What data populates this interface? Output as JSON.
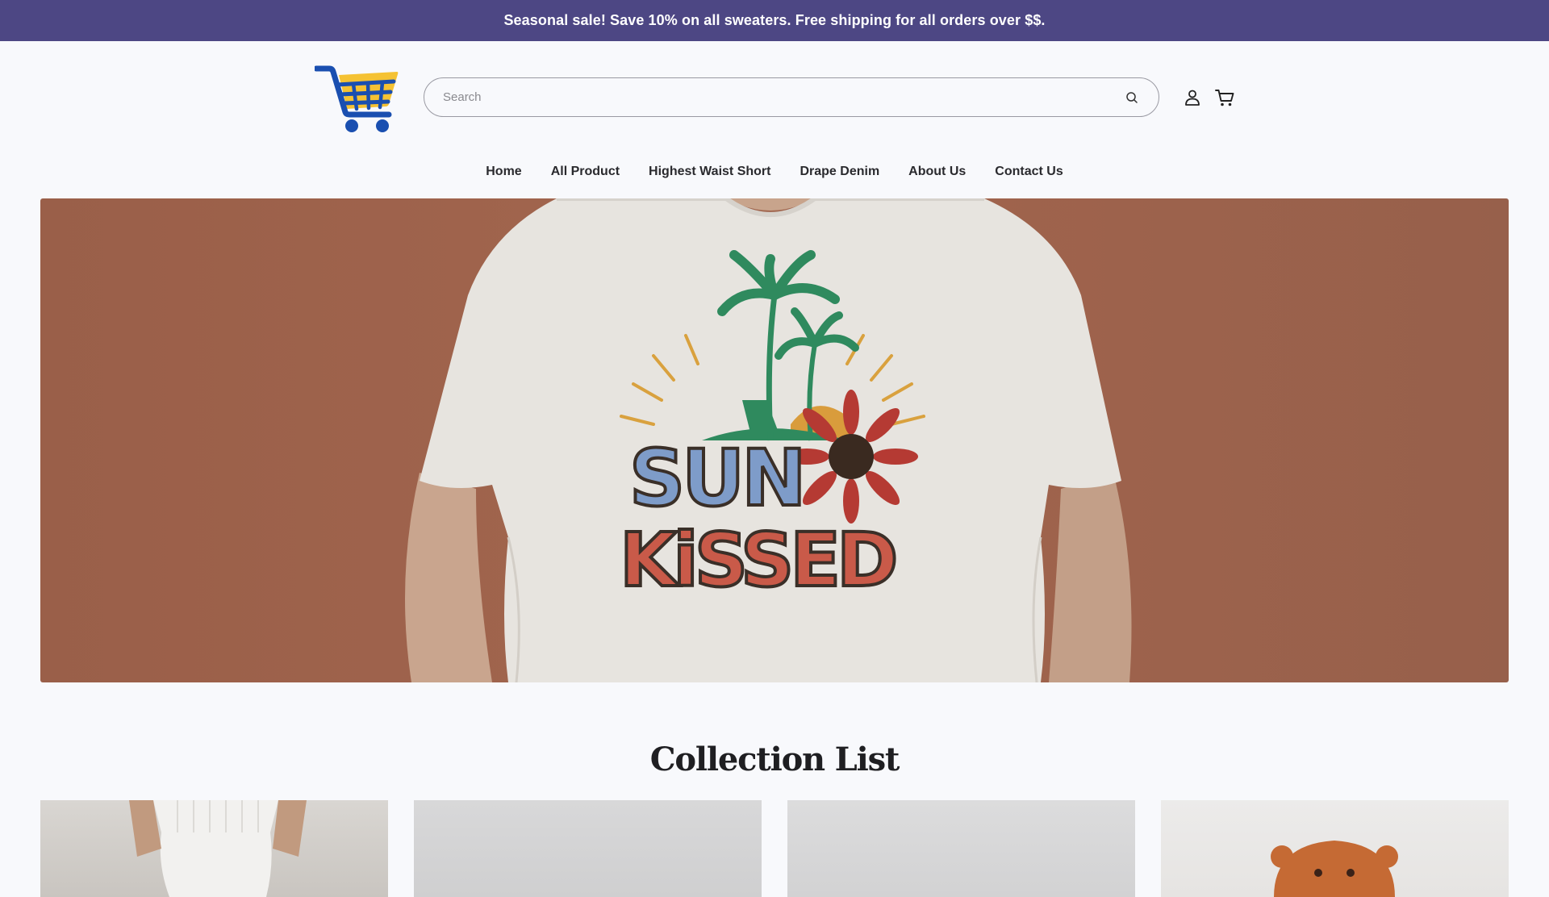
{
  "announcement": {
    "text": "Seasonal sale! Save 10% on all sweaters. Free shipping for all orders over $$."
  },
  "header": {
    "logo_icon": "shopping-cart-logo",
    "search": {
      "placeholder": "Search",
      "value": ""
    },
    "icons": {
      "search": "search-icon",
      "account": "user-icon",
      "cart": "cart-icon"
    }
  },
  "nav": {
    "items": [
      {
        "label": "Home"
      },
      {
        "label": "All Product"
      },
      {
        "label": "Highest Waist Short"
      },
      {
        "label": "Drape Denim"
      },
      {
        "label": "About Us"
      },
      {
        "label": "Contact Us"
      }
    ]
  },
  "hero": {
    "graphic_text_line1": "SUN",
    "graphic_text_line2": "KiSSED"
  },
  "collection": {
    "title": "Collection List"
  },
  "colors": {
    "announcement_bg": "#4d4784",
    "hero_bg": "#9f634c",
    "logo_blue": "#1a4fb0",
    "logo_yellow": "#f5c233"
  }
}
